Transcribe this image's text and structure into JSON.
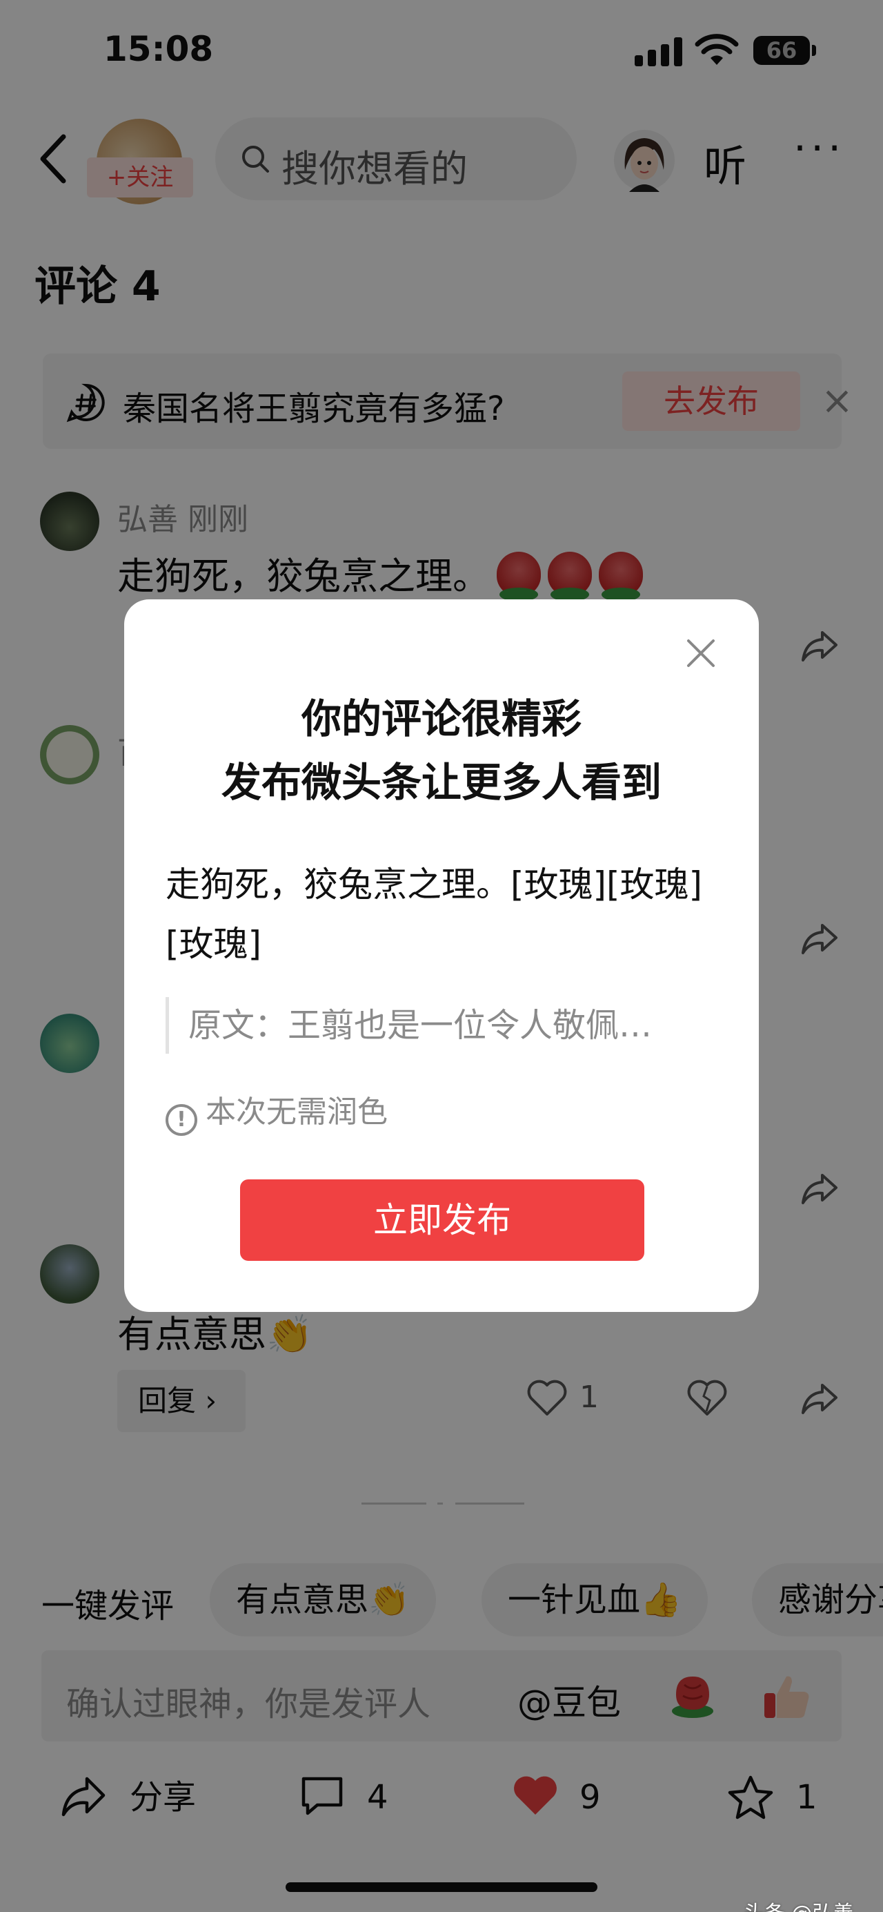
{
  "status_bar": {
    "time": "15:08",
    "battery": "66"
  },
  "header": {
    "follow_label": "+关注",
    "search_placeholder": "搜你想看的",
    "listen_label": "听",
    "more_label": "···"
  },
  "comments": {
    "title": "评论 4",
    "topic": {
      "text": "秦国名将王翦究竟有多猛?",
      "action": "去发布",
      "close": "×"
    },
    "items": [
      {
        "name": "弘善  刚刚",
        "text": "走狗死，狡兔烹之理。"
      },
      {
        "name": "百",
        "text": ""
      },
      {
        "name": "",
        "text": ""
      },
      {
        "name": "",
        "text": "有点意思👏"
      }
    ],
    "reply_label": "回复 ›",
    "like_count": "1"
  },
  "quick_comments": {
    "lead": "一键发评",
    "chips": [
      "有点意思👏",
      "一针见血👍",
      "感谢分享"
    ]
  },
  "input": {
    "placeholder": "确认过眼神，你是发评人",
    "mention": "@豆包"
  },
  "bottom_bar": {
    "share": "分享",
    "comment_count": "4",
    "like_count": "9",
    "favorite_count": "1"
  },
  "modal": {
    "title_line1": "你的评论很精彩",
    "title_line2": "发布微头条让更多人看到",
    "comment_text": "走狗死，狡兔烹之理。[玫瑰][玫瑰][玫瑰]",
    "quote": "原文：王翦也是一位令人敬佩…",
    "tip": "本次无需润色",
    "publish_button": "立即发布"
  },
  "watermark": "头条 @弘善",
  "colors": {
    "accent": "#f04142",
    "accent_light": "#fde3df"
  }
}
